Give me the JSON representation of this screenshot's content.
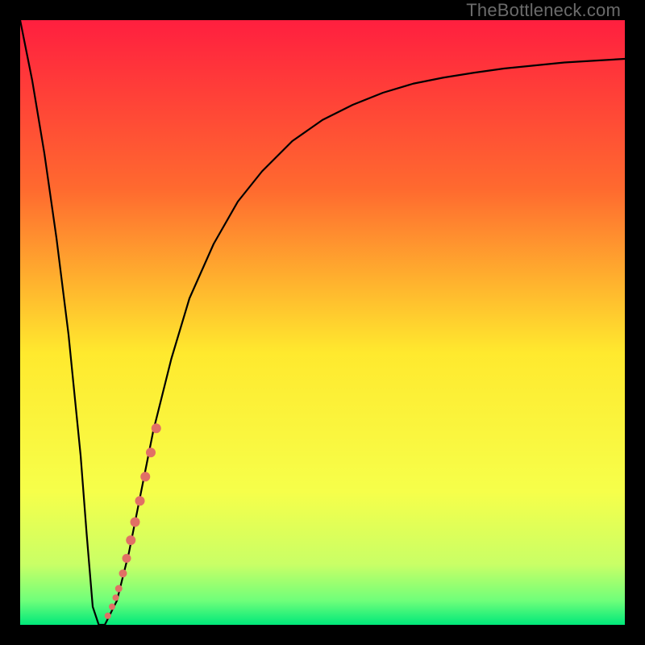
{
  "watermark": "TheBottleneck.com",
  "chart_data": {
    "type": "line",
    "title": "",
    "xlabel": "",
    "ylabel": "",
    "xlim": [
      0,
      100
    ],
    "ylim": [
      0,
      100
    ],
    "grid": false,
    "legend": false,
    "background_gradient": {
      "top": "#ff1f3f",
      "mid_upper": "#ff8e34",
      "mid": "#ffe92e",
      "mid_lower": "#eaff66",
      "lower": "#8cff7a",
      "bottom": "#00e87a"
    },
    "series": [
      {
        "name": "bottleneck-curve",
        "color": "#000000",
        "x": [
          0,
          2,
          4,
          6,
          8,
          10,
          11,
          12,
          13,
          14,
          16,
          18,
          20,
          22,
          25,
          28,
          32,
          36,
          40,
          45,
          50,
          55,
          60,
          65,
          70,
          75,
          80,
          85,
          90,
          95,
          100
        ],
        "y": [
          100,
          90,
          78,
          64,
          48,
          28,
          15,
          3,
          0,
          0,
          4,
          12,
          22,
          32,
          44,
          54,
          63,
          70,
          75,
          80,
          83.5,
          86,
          88,
          89.5,
          90.5,
          91.3,
          92,
          92.5,
          93,
          93.3,
          93.6
        ]
      }
    ],
    "markers": {
      "name": "highlighted-points",
      "color": "#e17065",
      "points": [
        {
          "x": 14.5,
          "y": 1.5,
          "r": 4
        },
        {
          "x": 15.2,
          "y": 3.0,
          "r": 4
        },
        {
          "x": 15.8,
          "y": 4.5,
          "r": 4
        },
        {
          "x": 16.3,
          "y": 6.0,
          "r": 4.5
        },
        {
          "x": 17.0,
          "y": 8.5,
          "r": 5
        },
        {
          "x": 17.6,
          "y": 11.0,
          "r": 5.5
        },
        {
          "x": 18.3,
          "y": 14.0,
          "r": 6
        },
        {
          "x": 19.0,
          "y": 17.0,
          "r": 6
        },
        {
          "x": 19.8,
          "y": 20.5,
          "r": 6
        },
        {
          "x": 20.7,
          "y": 24.5,
          "r": 6
        },
        {
          "x": 21.6,
          "y": 28.5,
          "r": 6
        },
        {
          "x": 22.5,
          "y": 32.5,
          "r": 6
        }
      ]
    }
  }
}
